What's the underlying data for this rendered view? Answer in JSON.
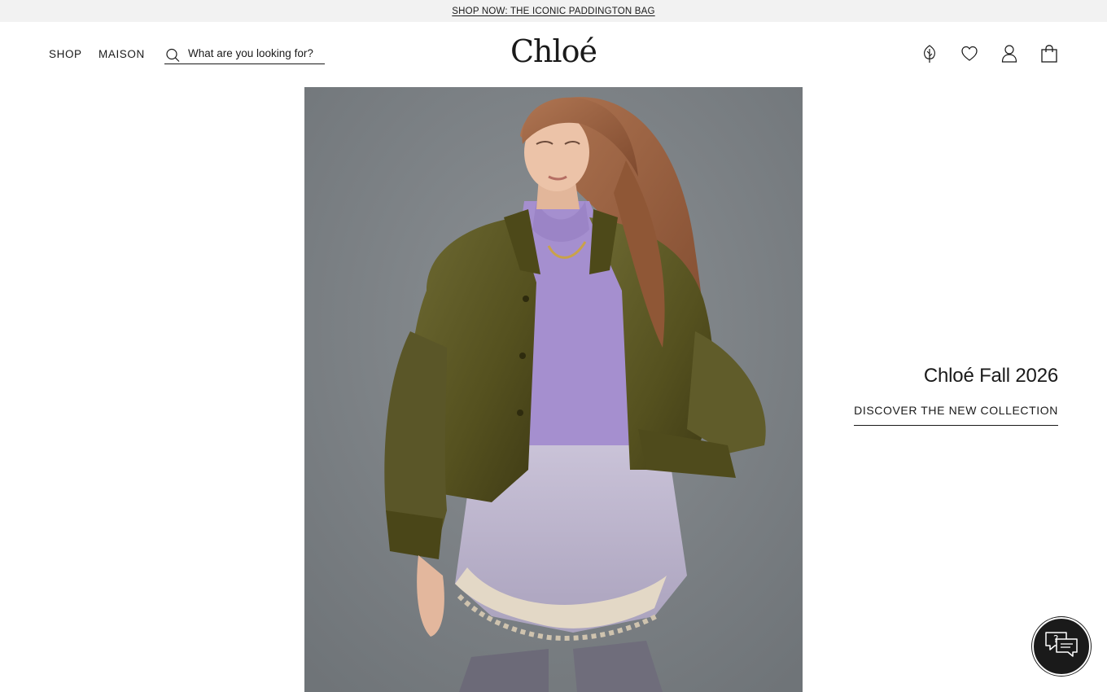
{
  "promo": {
    "text": "SHOP NOW: THE ICONIC PADDINGTON BAG"
  },
  "nav": {
    "shop": "SHOP",
    "maison": "MAISON"
  },
  "search": {
    "placeholder": "What are you looking for?"
  },
  "logo": {
    "text": "Chloé"
  },
  "header_icons": [
    "sustainability-icon",
    "heart-icon",
    "account-icon",
    "bag-icon"
  ],
  "hero": {
    "title": "Chloé Fall 2026",
    "cta": "DISCOVER THE NEW COLLECTION"
  },
  "chat": {
    "icon": "chat-help-icon"
  },
  "colors": {
    "text": "#1a1a1a",
    "promo_bg": "#f2f2f2",
    "backdrop_grey": "#7f8488",
    "jacket_olive": "#5a5528",
    "sweater_lilac": "#a58fcf",
    "skirt_lavender": "#bfb7cf",
    "lace_cream": "#e3d8c6",
    "hair_auburn": "#9a5f3e"
  }
}
